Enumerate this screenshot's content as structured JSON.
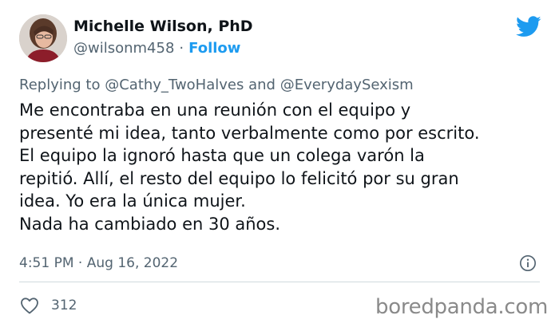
{
  "author": {
    "name": "Michelle Wilson, PhD",
    "handle": "@wilsonm458",
    "separator": "·",
    "follow_label": "Follow"
  },
  "reply": {
    "prefix": "Replying to",
    "mention1": "@Cathy_TwoHalves",
    "conjunction": "and",
    "mention2": "@EverydaySexism"
  },
  "tweet": {
    "lines": [
      "Me encontraba en una reunión con el equipo y",
      "presenté mi idea, tanto verbalmente como por escrito.",
      "El equipo la ignoró hasta que un colega varón la",
      "repitió. Allí, el resto del equipo lo felicitó por su gran",
      "idea. Yo era la única mujer.",
      "Nada ha cambiado en 30 años."
    ],
    "time": "4:51 PM",
    "separator": "·",
    "date": "Aug 16, 2022"
  },
  "engagement": {
    "likes": "312"
  },
  "watermark": "boredpanda.com",
  "colors": {
    "accent": "#1d9bf0",
    "text": "#0f1419",
    "secondary": "#536471",
    "divider": "#cfd9de"
  },
  "icons": {
    "brand": "twitter-bird-icon",
    "info": "info-icon",
    "like": "heart-icon"
  }
}
